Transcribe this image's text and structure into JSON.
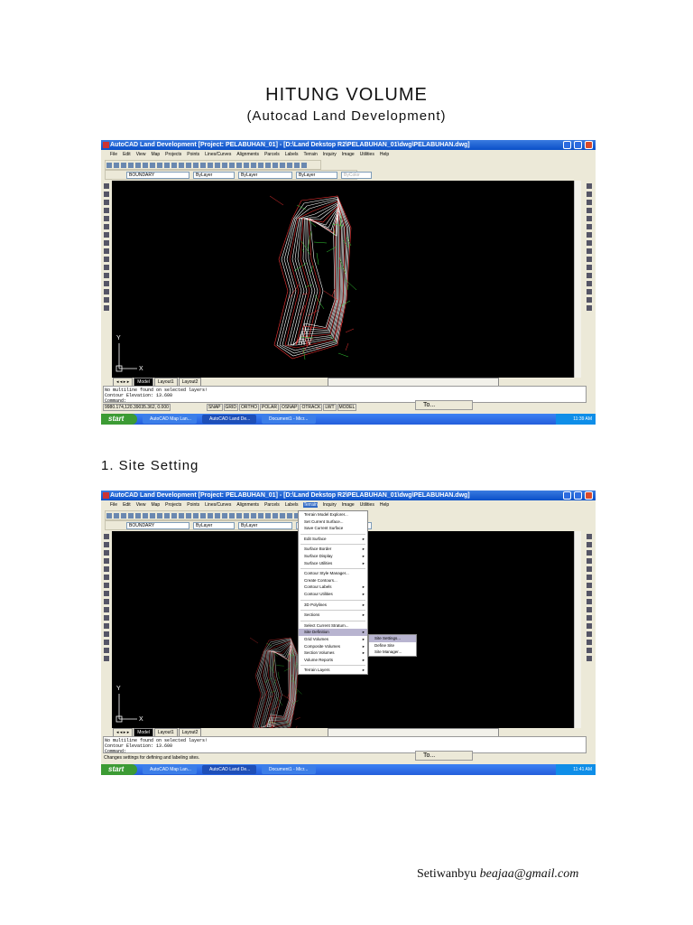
{
  "doc": {
    "title": "HITUNG VOLUME",
    "subtitle": "(Autocad Land Development)",
    "section1": "1. Site Setting",
    "author": "Setiwanbyu",
    "email": "beajaa@gmail.com"
  },
  "app": {
    "title": "AutoCAD Land Development [Project: PELABUHAN_01] - [D:\\Land Dekstop R2\\PELABUHAN_01\\dwg\\PELABUHAN.dwg]",
    "menus": [
      "File",
      "Edit",
      "View",
      "Map",
      "Projects",
      "Points",
      "Lines/Curves",
      "Alignments",
      "Parcels",
      "Labels",
      "Terrain",
      "Inquiry",
      "Image",
      "Utilities",
      "Help"
    ],
    "layer": "BOUNDARY",
    "color": "ByLayer",
    "linetype": "ByLayer",
    "lineweight": "ByLayer",
    "plotstyle": "ByColor",
    "tabs": [
      "Model",
      "Layout1",
      "Layout2"
    ],
    "command_lines": [
      "No multiline found on selected layers!",
      "Contour Elevation: 13.600",
      "Command:"
    ],
    "coords": "9980.174,120.39035.362, 0.000",
    "status_buttons": [
      "SNAP",
      "GRID",
      "ORTHO",
      "POLAR",
      "OSNAP",
      "OTRACK",
      "LWT",
      "MODEL"
    ],
    "mini_window": "To...",
    "taskbar": {
      "start": "start",
      "items": [
        "AutoCAD Map Lan...",
        "AutoCAD Land De...",
        "Document1 - Micr..."
      ]
    },
    "axis_x": "X",
    "axis_y": "Y"
  },
  "screens": [
    {
      "clock": "11:39 AM"
    },
    {
      "clock": "11:41 AM",
      "status_hint": "Changes settings for defining and labeling sites."
    }
  ],
  "terrain_menu": [
    {
      "label": "Terrain Model Explorer...",
      "sub": false
    },
    {
      "label": "Set Current Surface...",
      "sub": false
    },
    {
      "label": "Save Current Surface",
      "sub": false
    },
    {
      "sep": true
    },
    {
      "label": "Edit Surface",
      "sub": true
    },
    {
      "sep": true
    },
    {
      "label": "Surface Border",
      "sub": true
    },
    {
      "label": "Surface Display",
      "sub": true
    },
    {
      "label": "Surface Utilities",
      "sub": true
    },
    {
      "sep": true
    },
    {
      "label": "Contour Style Manager...",
      "sub": false
    },
    {
      "label": "Create Contours...",
      "sub": false
    },
    {
      "label": "Contour Labels",
      "sub": true
    },
    {
      "label": "Contour Utilities",
      "sub": true
    },
    {
      "sep": true
    },
    {
      "label": "3D Polylines",
      "sub": true
    },
    {
      "sep": true
    },
    {
      "label": "Sections",
      "sub": true
    },
    {
      "sep": true
    },
    {
      "label": "Select Current Stratum...",
      "sub": false
    },
    {
      "label": "Site Definition",
      "sub": true,
      "highlight": true
    },
    {
      "label": "Grid Volumes",
      "sub": true
    },
    {
      "label": "Composite Volumes",
      "sub": true
    },
    {
      "label": "Section Volumes",
      "sub": true
    },
    {
      "label": "Volume Reports",
      "sub": true
    },
    {
      "sep": true
    },
    {
      "label": "Terrain Layers",
      "sub": true
    }
  ],
  "site_submenu": [
    "Site Settings...",
    "Define Site",
    "Site Manager..."
  ],
  "submenu_arrow": "▸"
}
